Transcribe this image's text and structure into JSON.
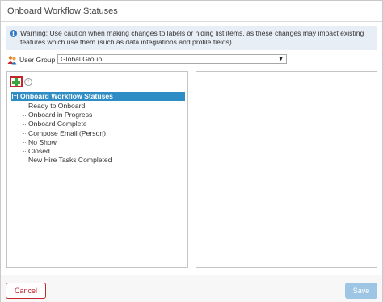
{
  "dialog": {
    "title": "Onboard Workflow Statuses"
  },
  "warning": {
    "icon": "info-icon",
    "text": "Warning: Use caution when making changes to labels or hiding list items, as these changes may impact existing features which use them (such as data integrations and profile fields)."
  },
  "user_group": {
    "label": "User Group",
    "icon": "user-group-icon",
    "selected": "Global Group"
  },
  "toolbar": {
    "add_icon": "plus-icon",
    "collapse_icon": "collapse-icon"
  },
  "tree": {
    "root_label": "Onboard Workflow Statuses",
    "root_toggle": "−",
    "items": [
      "Ready to Onboard",
      "Onboard in Progress",
      "Onboard Complete",
      "Compose Email (Person)",
      "No Show",
      "Closed",
      "New Hire Tasks Completed"
    ]
  },
  "footer": {
    "cancel_label": "Cancel",
    "save_label": "Save"
  },
  "colors": {
    "accent_blue": "#2f8dc5",
    "cancel_red": "#c0262c",
    "save_disabled": "#9ec6e4",
    "add_green": "#3aa53a"
  }
}
